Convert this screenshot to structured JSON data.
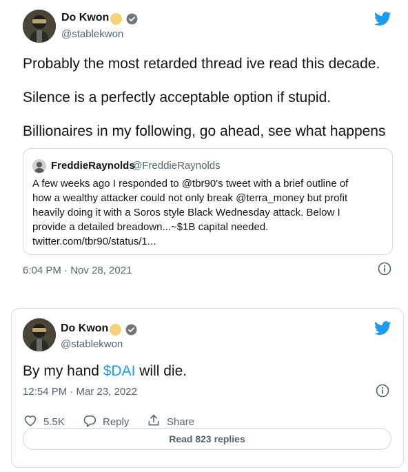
{
  "tweet1": {
    "author_name": "Do Kwon",
    "author_handle": "@stablekwon",
    "lines": [
      "Probably the most retarded thread ive read this decade.",
      "Silence is a perfectly acceptable option if stupid.",
      "Billionaires in my following, go ahead, see what happens"
    ],
    "quote": {
      "author_name": "FreddieRaynolds",
      "author_handle": "@FreddieRaynolds",
      "lines": [
        "A few weeks ago I responded to @tbr90's tweet with a brief outline of",
        "how a wealthy attacker could not only break @terra_money but profit",
        "heavily doing it with a Soros style Black Wednesday attack. Below I",
        "provide a detailed breadown...~$1B capital needed.",
        "twitter.com/tbr90/status/1..."
      ]
    },
    "timestamp": "6:04 PM · Nov 28, 2021"
  },
  "tweet2": {
    "author_name": "Do Kwon",
    "author_handle": "@stablekwon",
    "text_before": "By my hand ",
    "cashtag": "$DAI",
    "text_after": " will die.",
    "timestamp": "12:54 PM · Mar 23, 2022",
    "likes": "5.5K",
    "reply_label": "Reply",
    "share_label": "Share",
    "read_replies_label": "Read 823 replies"
  },
  "colors": {
    "twitter_blue": "#1d9bf0",
    "secondary_text": "#536471",
    "border": "#cfd9de",
    "dot_yellow": "#f4d27a"
  },
  "icons": [
    "twitter-bird-icon",
    "verified-badge-icon",
    "info-icon",
    "heart-icon",
    "reply-icon",
    "share-icon"
  ]
}
